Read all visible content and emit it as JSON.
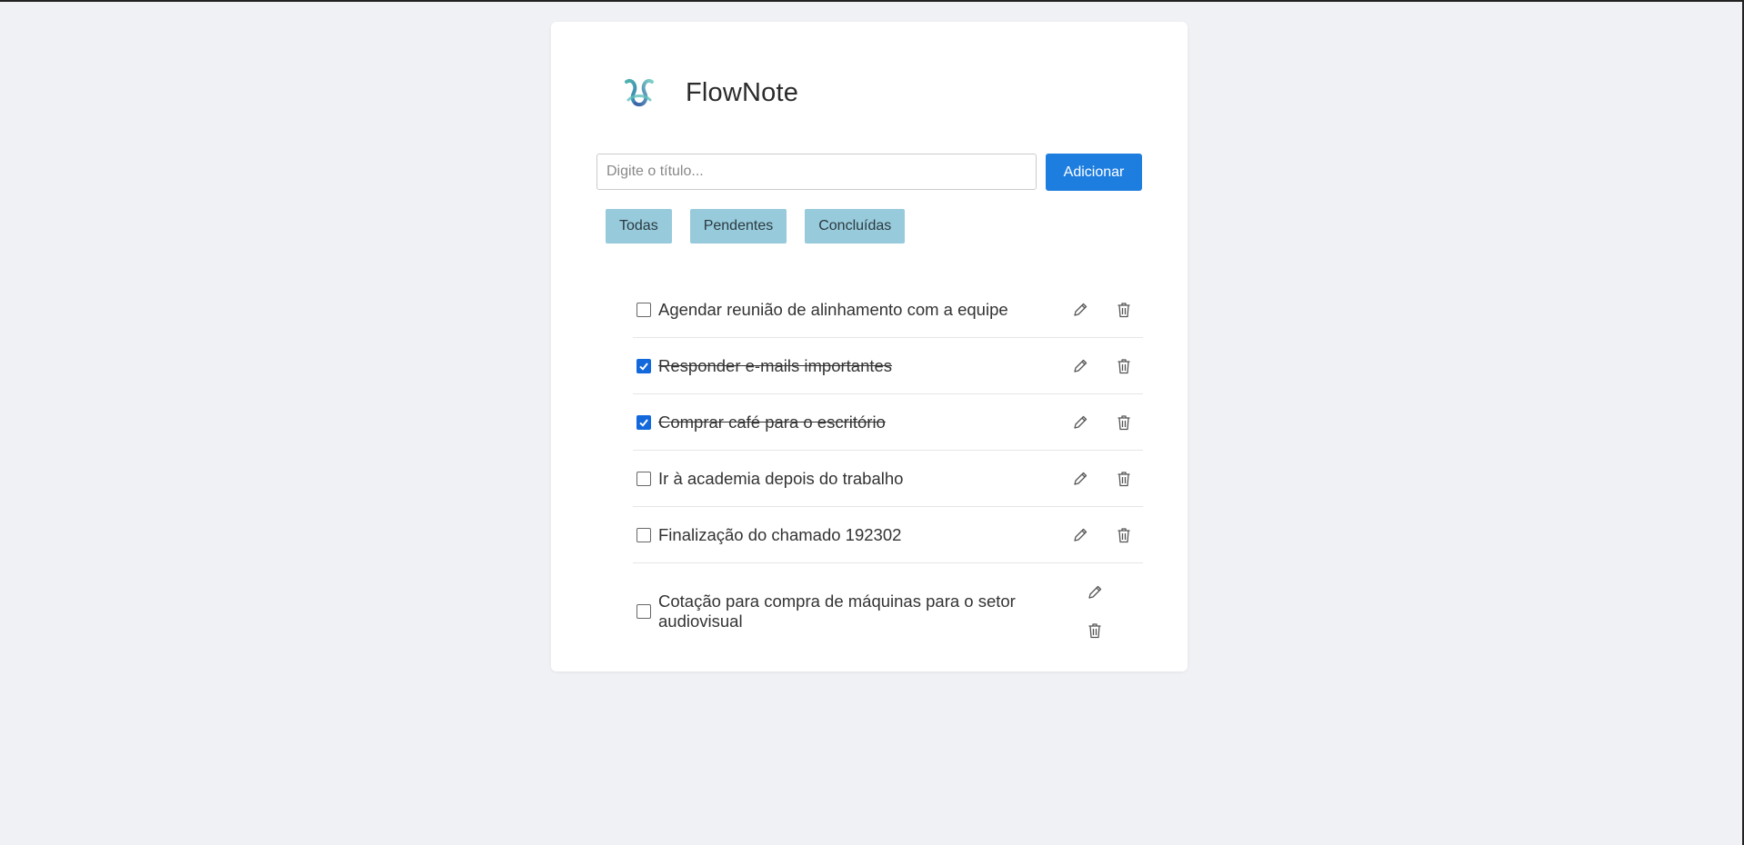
{
  "app": {
    "title": "FlowNote",
    "logo": "flownote-logo-icon"
  },
  "add_form": {
    "placeholder": "Digite o título...",
    "value": "",
    "add_label": "Adicionar"
  },
  "filters": [
    {
      "label": "Todas"
    },
    {
      "label": "Pendentes"
    },
    {
      "label": "Concluídas"
    }
  ],
  "tasks": [
    {
      "title": "Agendar reunião de alinhamento com a equipe",
      "done": false
    },
    {
      "title": "Responder e-mails importantes",
      "done": true
    },
    {
      "title": "Comprar café para o escritório",
      "done": true
    },
    {
      "title": "Ir à academia depois do trabalho",
      "done": false
    },
    {
      "title": "Finalização do chamado 192302",
      "done": false
    },
    {
      "title": "Cotação para compra de máquinas para o setor audiovisual",
      "done": false
    }
  ],
  "icons": {
    "edit": "pencil-icon",
    "delete": "trash-icon",
    "checked": "checkmark-icon"
  },
  "colors": {
    "accent": "#1e7ee0",
    "filter_bg": "#97cadb",
    "checkbox_checked": "#1368dc",
    "background": "#eff1f5"
  }
}
